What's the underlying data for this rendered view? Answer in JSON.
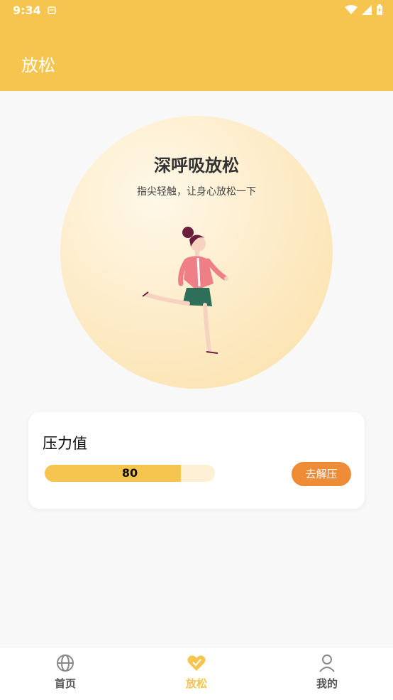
{
  "status": {
    "time": "9:34"
  },
  "appbar": {
    "title": "放松"
  },
  "hero": {
    "title": "深呼吸放松",
    "subtitle": "指尖轻触，让身心放松一下"
  },
  "stress_card": {
    "title": "压力值",
    "value": "80",
    "progress_percent": 80,
    "action_label": "去解压"
  },
  "nav": {
    "items": [
      {
        "label": "首页",
        "icon": "globe-icon"
      },
      {
        "label": "放松",
        "icon": "heart-icon"
      },
      {
        "label": "我的",
        "icon": "person-icon"
      }
    ],
    "active_color": "#f6c54f"
  },
  "colors": {
    "accent": "#f6c54f",
    "button": "#ee8b37"
  }
}
